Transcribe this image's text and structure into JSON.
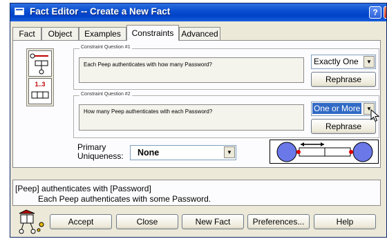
{
  "window": {
    "title": "Fact Editor -- Create a New Fact",
    "help_glyph": "?",
    "close_glyph": "✕"
  },
  "tabs": [
    "Fact",
    "Object",
    "Examples",
    "Constraints",
    "Advanced"
  ],
  "active_tab": "Constraints",
  "icon_panel": {
    "frequency_label": "1..3"
  },
  "q1": {
    "label": "Constraint Question #1",
    "text": "Each Peep authenticates with how many Password?",
    "answer": "Exactly One",
    "rephrase": "Rephrase"
  },
  "q2": {
    "label": "Constraint Question #2",
    "text": "How many Peep authenticates with each Password?",
    "answer": "One or More",
    "rephrase": "Rephrase"
  },
  "primary": {
    "label_line1": "Primary",
    "label_line2": "Uniqueness:",
    "value": "None"
  },
  "status": {
    "line1": "[Peep] authenticates with [Password]",
    "line2": "Each Peep authenticates with some Password."
  },
  "buttons": {
    "accept": "Accept",
    "close": "Close",
    "new_fact": "New Fact",
    "preferences": "Preferences...",
    "help": "Help"
  },
  "colors": {
    "title_blue": "#0a4fd0",
    "role_fill": "#6a78e8",
    "mandatory_dot": "#e00000",
    "face": "#ece9d8"
  }
}
